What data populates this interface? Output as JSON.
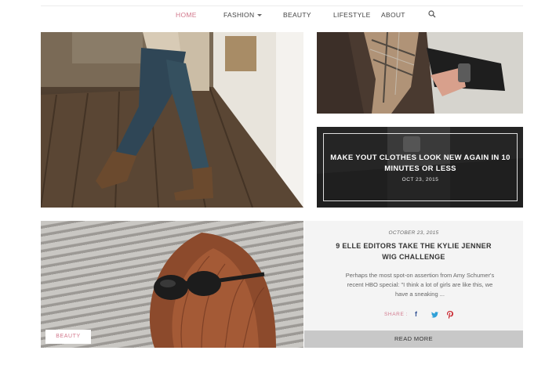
{
  "nav": {
    "items": [
      {
        "label": "HOME"
      },
      {
        "label": "FASHION"
      },
      {
        "label": "BEAUTY"
      },
      {
        "label": "LIFESTYLE"
      },
      {
        "label": "ABOUT"
      }
    ]
  },
  "featured": {
    "overlay_title": "MAKE YOUT CLOTHES LOOK NEW AGAIN IN 10 MINUTES OR LESS",
    "overlay_date": "OCT 23, 2015"
  },
  "post": {
    "category": "BEAUTY",
    "date": "OCTOBER 23, 2015",
    "title": "9 ELLE EDITORS TAKE THE KYLIE JENNER WIG CHALLENGE",
    "excerpt": "Perhaps the most spot-on assertion from Amy Schumer's recent HBO special: \"I think a lot of girls are like this, we have a sneaking ...",
    "share_label": "SHARE :",
    "read_more": "READ MORE"
  },
  "colors": {
    "accent": "#d2788c",
    "facebook": "#3b5998",
    "twitter": "#2fa0d8",
    "pinterest": "#c8232c"
  },
  "icons": {
    "search": "search-icon",
    "facebook": "facebook-icon",
    "twitter": "twitter-icon",
    "pinterest": "pinterest-icon"
  }
}
